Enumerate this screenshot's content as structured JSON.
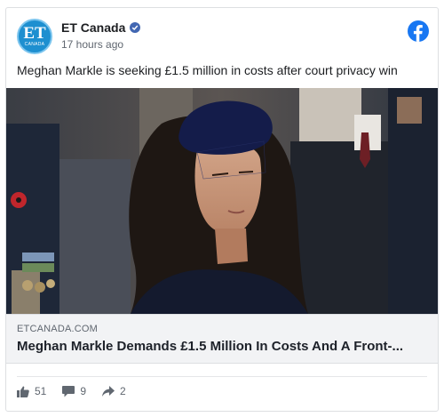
{
  "header": {
    "page_name": "ET Canada",
    "timestamp": "17 hours ago",
    "avatar_initials": "ET",
    "avatar_subtext": "CANADA"
  },
  "post": {
    "text": "Meghan Markle is seeking £1.5 million in costs after court privacy win"
  },
  "link": {
    "domain": "ETCANADA.COM",
    "headline": "Meghan Markle Demands £1.5 Million In Costs And A Front-..."
  },
  "stats": {
    "likes": "51",
    "comments": "9",
    "shares": "2"
  },
  "colors": {
    "brand_blue": "#1877f2",
    "verified": "#4267b2",
    "avatar": "#1d8fd0"
  },
  "icons": [
    "verified-badge-icon",
    "facebook-logo-icon",
    "like-icon",
    "comment-icon",
    "share-icon"
  ]
}
